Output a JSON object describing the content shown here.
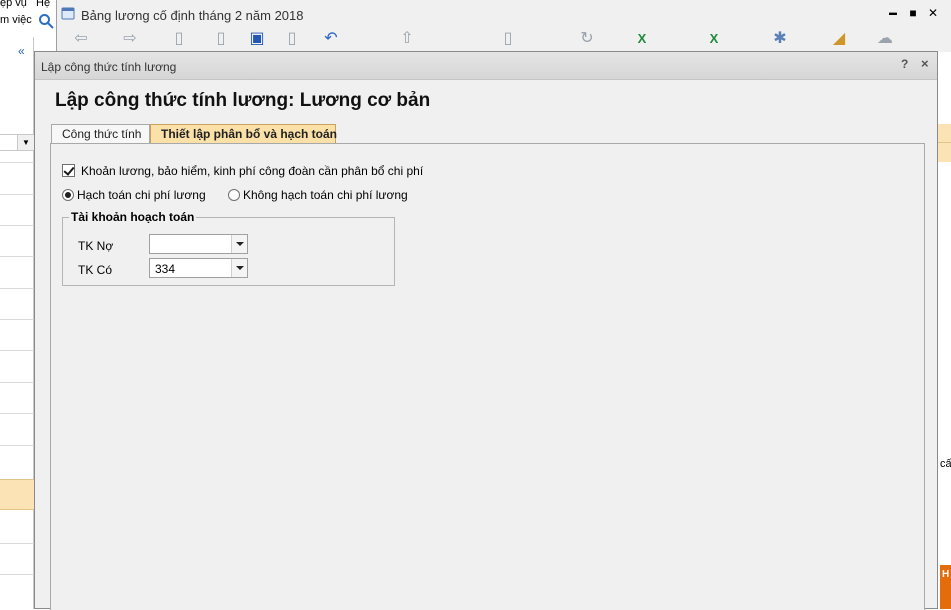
{
  "background_app": {
    "menu_items": [
      "ệp vụ",
      "Hệ"
    ],
    "work_label": "m việc",
    "collapse_label": "«",
    "right_partial_text": "cấ",
    "right_partial_button": "H"
  },
  "second_window": {
    "title": "Bảng lương cố định tháng 2 năm 2018",
    "controls": {
      "minimize": "▬",
      "maximize": "■",
      "close": "✕"
    }
  },
  "dialog": {
    "title": "Lập công thức tính lương",
    "help_label": "?",
    "close_label": "×",
    "heading": "Lập công thức tính lương: Lương cơ bản",
    "tabs": [
      {
        "label": "Công thức tính",
        "active": false
      },
      {
        "label": "Thiết lập phân bổ và hạch toán",
        "active": true
      }
    ],
    "allocation": {
      "checkbox_label": "Khoản lương, bảo hiểm, kinh phí công đoàn cần phân bổ chi phí",
      "checkbox_checked": true,
      "radio_options": [
        {
          "label": "Hạch toán chi phí lương",
          "selected": true
        },
        {
          "label": "Không hạch toán chi phí lương",
          "selected": false
        }
      ],
      "group_title": "Tài khoản hoạch toán",
      "debit_label": "TK Nợ",
      "debit_value": "",
      "credit_label": "TK Có",
      "credit_value": "334"
    }
  },
  "colors": {
    "active_tab": "#fbe0a8",
    "dialog_bg": "#f0f0f0",
    "selection_row": "#fbe3b6",
    "orange_button": "#e46c0a"
  }
}
